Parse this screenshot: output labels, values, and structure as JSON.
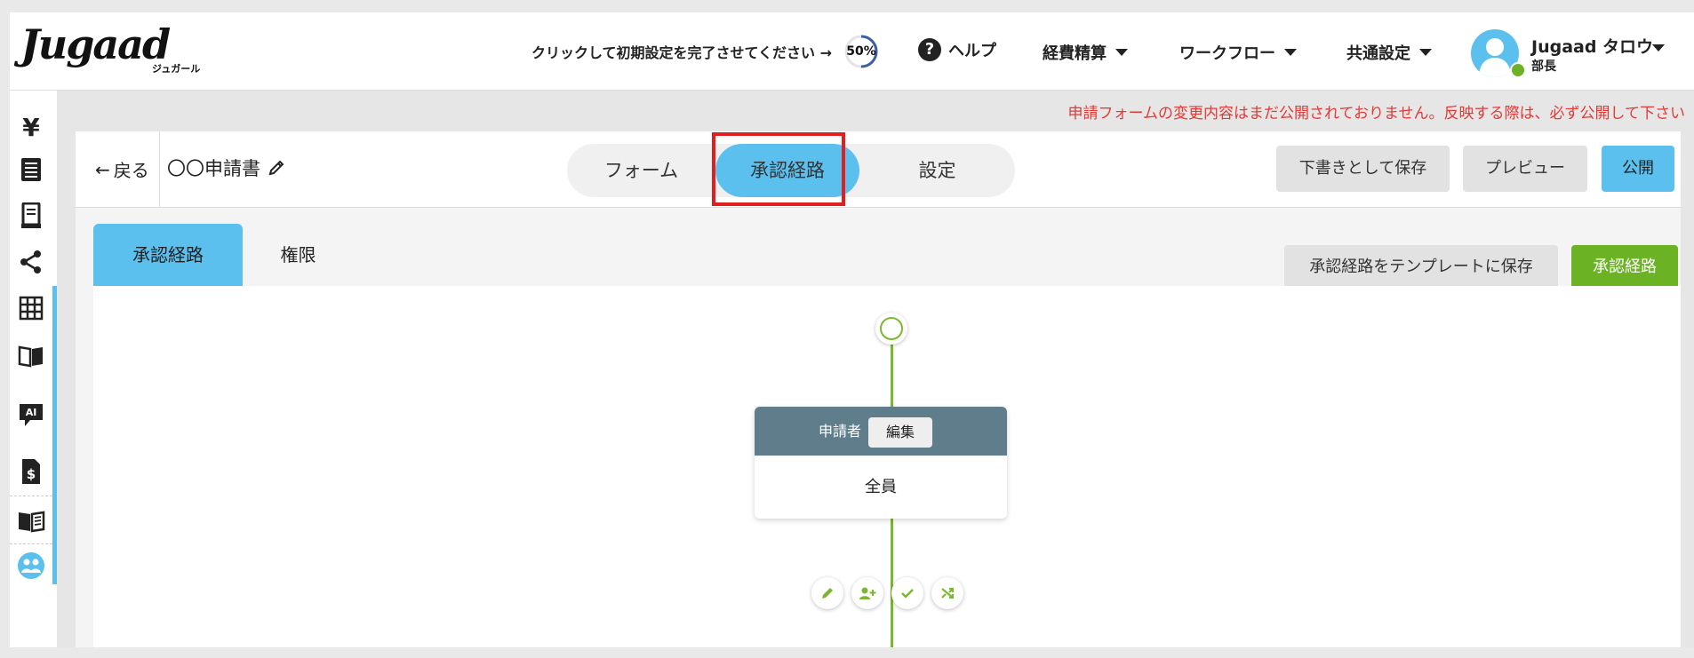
{
  "header": {
    "logo": "Jugaad",
    "logo_sub": "ジュガール",
    "setup_prompt": "クリックして初期設定を完了させてください →",
    "setup_progress": "50%",
    "setup_progress_value": 0.5,
    "help_label": "ヘルプ",
    "nav": [
      "経費精算",
      "ワークフロー",
      "共通設定"
    ],
    "user_name": "Jugaad タロウ",
    "user_role": "部長"
  },
  "sidebar": {
    "items": [
      "yen-icon",
      "receipt-icon",
      "invoice-icon",
      "share-icon",
      "grid-icon",
      "book-icon",
      "ai-chat-icon",
      "dollar-doc-icon",
      "manual-icon",
      "people-icon"
    ]
  },
  "warning": "申請フォームの変更内容はまだ公開されておりません。反映する際は、必ず公開して下さい",
  "toolbar": {
    "back_label": "戻る",
    "form_name": "〇〇申請書",
    "tabs": [
      "フォーム",
      "承認経路",
      "設定"
    ],
    "active_tab": "承認経路",
    "save_draft": "下書きとして保存",
    "preview": "プレビュー",
    "publish": "公開"
  },
  "subtabs": {
    "items": [
      "承認経路",
      "権限"
    ],
    "save_template": "承認経路をテンプレートに保存",
    "route_button": "承認経路"
  },
  "flow": {
    "node_title": "申請者",
    "node_edit": "編集",
    "node_body": "全員"
  },
  "colors": {
    "accent": "#5bc0ee",
    "green": "#7cb82f",
    "warning": "#e53935",
    "node_header": "#607d8b"
  }
}
